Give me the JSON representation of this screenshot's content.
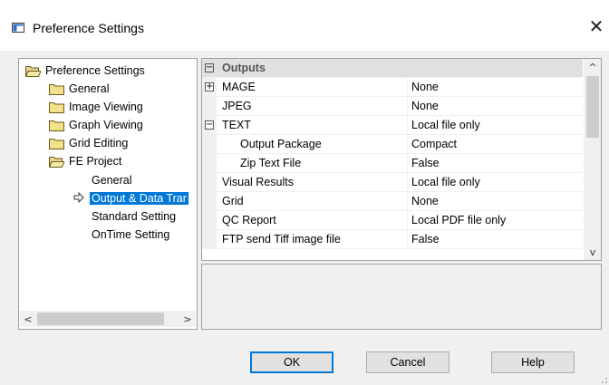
{
  "window": {
    "title": "Preference Settings",
    "close_glyph": "✕"
  },
  "tree": {
    "items": [
      {
        "label": "Preference Settings",
        "icon": "open-folder-icon"
      },
      {
        "label": "General",
        "icon": "folder-icon"
      },
      {
        "label": "Image Viewing",
        "icon": "folder-icon"
      },
      {
        "label": "Graph Viewing",
        "icon": "folder-icon"
      },
      {
        "label": "Grid Editing",
        "icon": "folder-icon"
      },
      {
        "label": "FE Project",
        "icon": "open-folder-icon"
      },
      {
        "label": "General"
      },
      {
        "label": "Output & Data Trar",
        "selected": true
      },
      {
        "label": "Standard Setting"
      },
      {
        "label": "OnTime Setting"
      }
    ],
    "scroll_left": "<",
    "scroll_right": ">"
  },
  "grid": {
    "category": "Outputs",
    "category_toggle": "⊟",
    "rows": [
      {
        "name": "MAGE",
        "value": "None",
        "toggle": "+"
      },
      {
        "name": "JPEG",
        "value": "None"
      },
      {
        "name": "TEXT",
        "value": "Local file only",
        "toggle": "−"
      },
      {
        "name": "Output Package",
        "value": "Compact"
      },
      {
        "name": "Zip Text File",
        "value": "False"
      },
      {
        "name": "Visual Results",
        "value": "Local file only"
      },
      {
        "name": "Grid",
        "value": "None"
      },
      {
        "name": "QC Report",
        "value": "Local PDF file only"
      },
      {
        "name": "FTP send Tiff image file",
        "value": "False"
      }
    ],
    "scroll_up": "^",
    "scroll_down": "v"
  },
  "buttons": {
    "ok": "OK",
    "cancel": "Cancel",
    "help": "Help"
  },
  "colors": {
    "selection": "#0078d7",
    "category_bg": "#e0e0e0",
    "window_bg": "#f0f0f0"
  }
}
